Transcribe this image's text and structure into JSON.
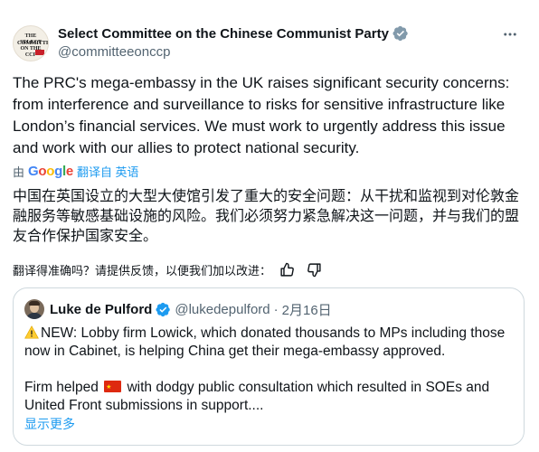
{
  "author": {
    "display_name": "Select Committee on the Chinese Communist Party",
    "handle": "@committeeonccp",
    "avatar_lines": [
      "THE SELECT",
      "COMMITTEE",
      "ON THE",
      "CCP"
    ],
    "verified_color": "#829aab"
  },
  "tweet": {
    "text": "The PRC's mega-embassy in the UK raises significant security concerns: from interference and surveillance to risks for sensitive infrastructure like London’s financial services. We must work to urgently address this issue and work with our allies to protect national security."
  },
  "translation": {
    "by_label": "由",
    "google_letters": [
      "G",
      "o",
      "o",
      "g",
      "l",
      "e"
    ],
    "link_label": "翻译自 英语",
    "translated_text": "中国在英国设立的大型大使馆引发了重大的安全问题：从干扰和监视到对伦敦金融服务等敏感基础设施的风险。我们必须努力紧急解决这一问题，并与我们的盟友合作保护国家安全。",
    "feedback_prompt": "翻译得准确吗？请提供反馈，以便我们加以改进：",
    "thumbs_up_icon": "thumbs-up-icon",
    "thumbs_down_icon": "thumbs-down-icon"
  },
  "quoted": {
    "display_name": "Luke de Pulford",
    "handle": "@lukedepulford",
    "separator": "·",
    "date": "2月16日",
    "verified_color": "#1d9bf0",
    "para1": "NEW: Lobby firm Lowick, which donated thousands to MPs including those now in Cabinet, is helping China get their mega-embassy approved.",
    "para2_before_flag": "Firm helped",
    "para2_after_flag": "with dodgy public consultation which resulted in SOEs and United Front submissions in support....",
    "show_more": "显示更多"
  },
  "colors": {
    "link": "#1d9bf0",
    "secondary_text": "#536471",
    "border": "#cfd9de"
  }
}
